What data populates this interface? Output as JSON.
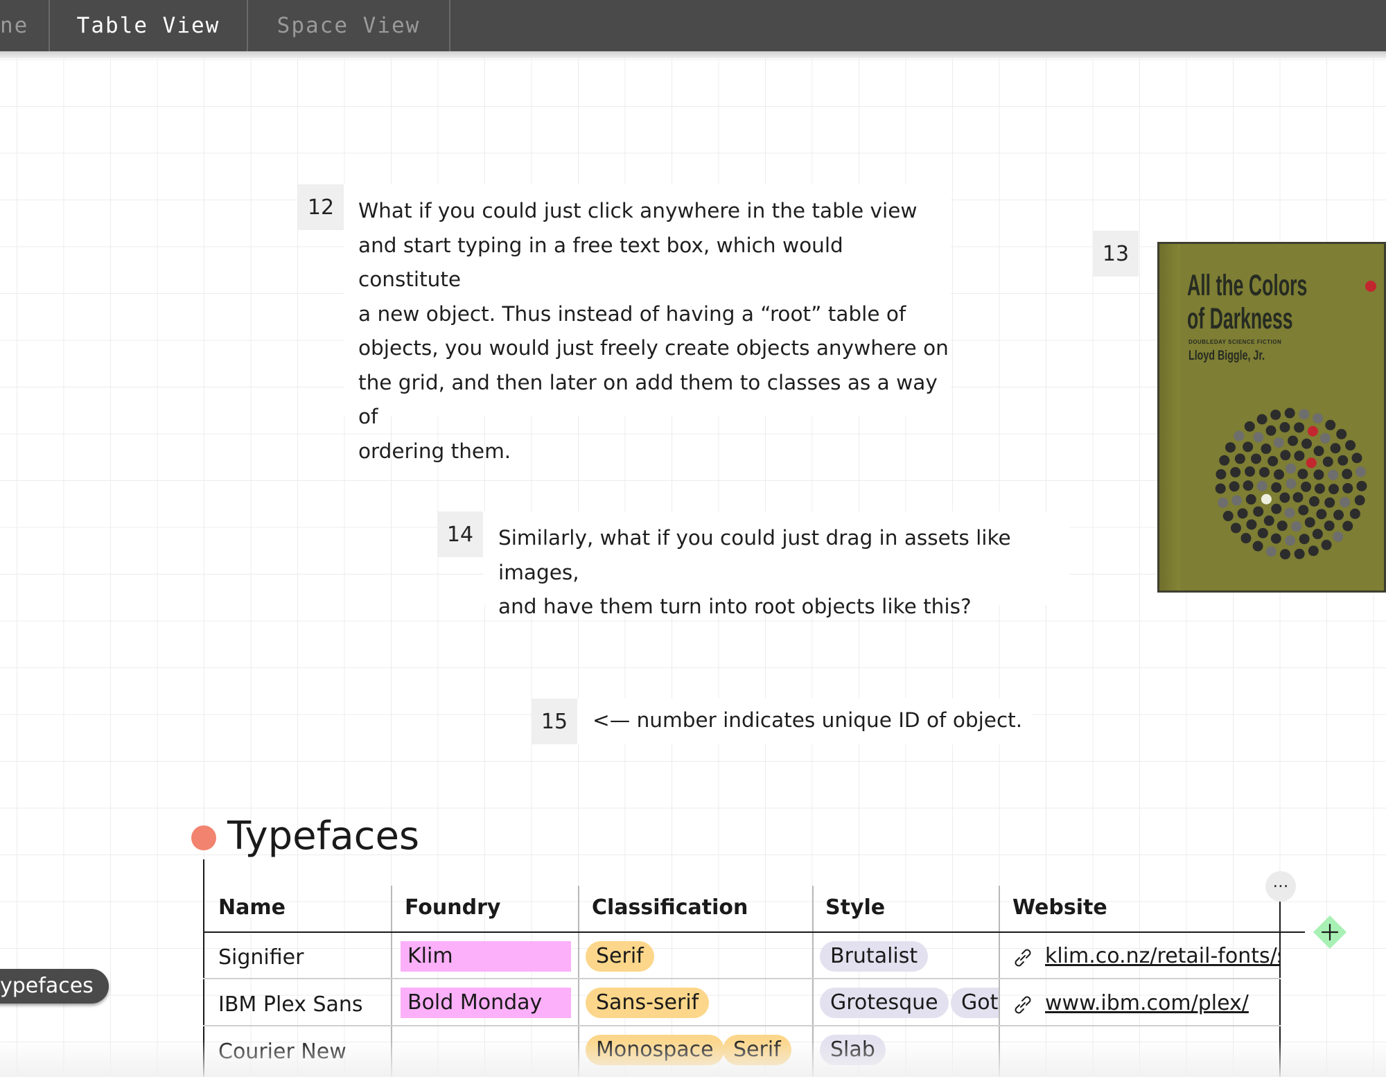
{
  "tabs": {
    "partial_label": "ne",
    "table_view": "Table View",
    "space_view": "Space View"
  },
  "objects": {
    "o12": {
      "id": "12",
      "lines": [
        "What if you could just click anywhere in the table view",
        "and start typing in a free text box, which would constitute",
        "a new object. Thus instead of having a “root” table of",
        "objects, you would just freely create objects anywhere on",
        "the grid, and then later on add them to classes as a way of",
        "ordering them."
      ]
    },
    "o13": {
      "id": "13",
      "book": {
        "title_line1": "All the Colors",
        "title_line2": "of Darkness",
        "series": "DOUBLEDAY SCIENCE FICTION",
        "author": "Lloyd Biggle, Jr."
      }
    },
    "o14": {
      "id": "14",
      "lines": [
        "Similarly, what if you could just drag in assets like images,",
        "and have them turn into root objects like this?"
      ]
    },
    "o15": {
      "id": "15",
      "text": "<— number indicates unique ID of object."
    }
  },
  "typefaces": {
    "title": "Typefaces",
    "dot_color": "#f2836f",
    "side_label": "ypefaces",
    "more_label": "···",
    "columns": [
      "Name",
      "Foundry",
      "Classification",
      "Style",
      "Website"
    ],
    "rows": [
      {
        "name": "Signifier",
        "foundry": "Klim",
        "classification": [
          "Serif"
        ],
        "style": [
          "Brutalist"
        ],
        "website": "klim.co.nz/retail-fonts/s"
      },
      {
        "name": "IBM Plex Sans",
        "foundry": "Bold Monday",
        "classification": [
          "Sans-serif"
        ],
        "style": [
          "Grotesque",
          "Goth"
        ],
        "website": "www.ibm.com/plex/"
      },
      {
        "name": "Courier New",
        "foundry": "",
        "classification": [
          "Monospace",
          "Serif"
        ],
        "style": [
          "Slab"
        ],
        "website": ""
      }
    ]
  },
  "colors": {
    "topbar": "#4a4a4a",
    "foundry_tag": "#fbb0f9",
    "classification_tag": "#fcd68a",
    "style_tag": "#e3e1ef",
    "add_button": "#a8f0b4"
  }
}
